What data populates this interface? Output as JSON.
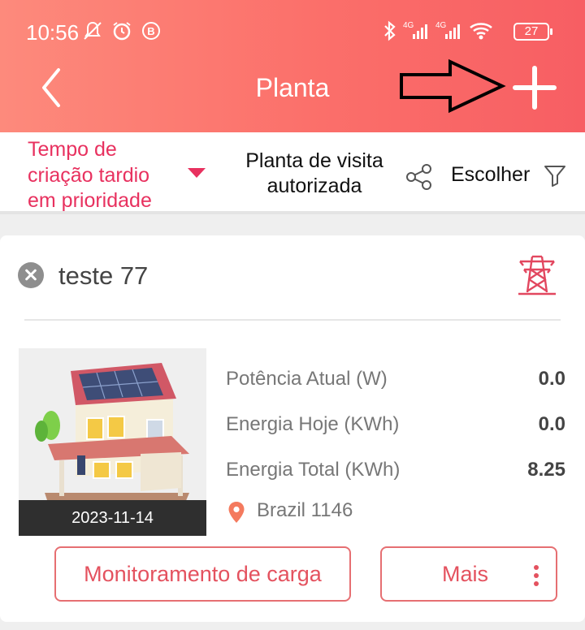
{
  "status_bar": {
    "time": "10:56",
    "battery": "27",
    "icons": [
      "mute-icon",
      "alarm-icon",
      "b-badge-icon",
      "bluetooth-icon",
      "signal-4g-icon",
      "signal-4g-icon",
      "wifi-icon",
      "battery-icon"
    ],
    "network_label": "4G"
  },
  "header": {
    "title": "Planta",
    "back_icon": "chevron-left-icon",
    "add_icon": "plus-icon",
    "background_colors": [
      "#fd8a7c",
      "#f75e63"
    ]
  },
  "filters": {
    "sort_label": "Tempo de criação tardio em prioridade",
    "sort_color": "#e8315f",
    "authorized_label": "Planta de visita autorizada",
    "share_icon": "share-icon",
    "choose_label": "Escolher",
    "filter_icon": "funnel-icon"
  },
  "plant_card": {
    "name": "teste 77",
    "type_icon": "transmission-tower-icon",
    "image_date": "2023-11-14",
    "stats": [
      {
        "label": "Potência Atual (W)",
        "value": "0.0"
      },
      {
        "label": "Energia Hoje (KWh)",
        "value": "0.0"
      },
      {
        "label": "Energia Total (KWh)",
        "value": "8.25"
      }
    ],
    "location": "Brazil 1146",
    "buttons": {
      "load_monitoring": "Monitoramento de carga",
      "more": "Mais"
    },
    "accent_color": "#e4525f"
  }
}
